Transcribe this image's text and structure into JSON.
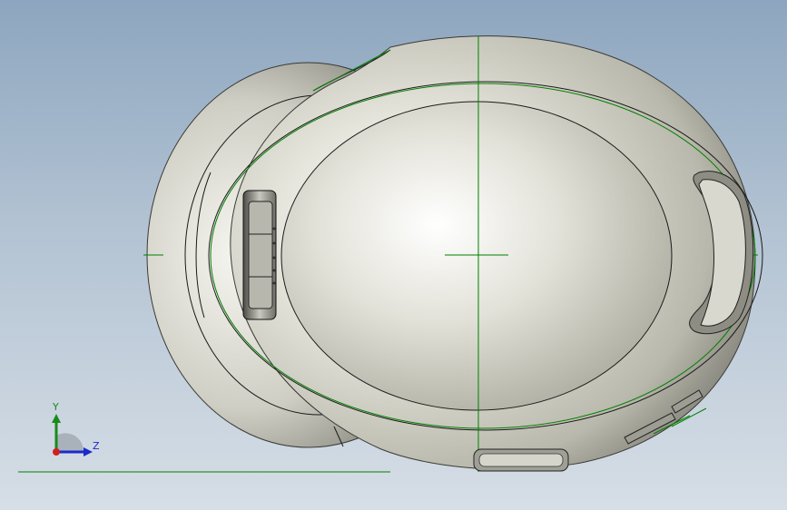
{
  "viewport": {
    "background_top": "#8da6bf",
    "background_bottom": "#d6dee6"
  },
  "model": {
    "body_color": "#d7d6cc",
    "edge_color": "#000000",
    "sketch_color": "#008000"
  },
  "triad": {
    "y_label": "Y",
    "z_label": "Z",
    "y_color": "#1a8a1a",
    "z_color": "#1a2acc",
    "x_color": "#d02020"
  }
}
